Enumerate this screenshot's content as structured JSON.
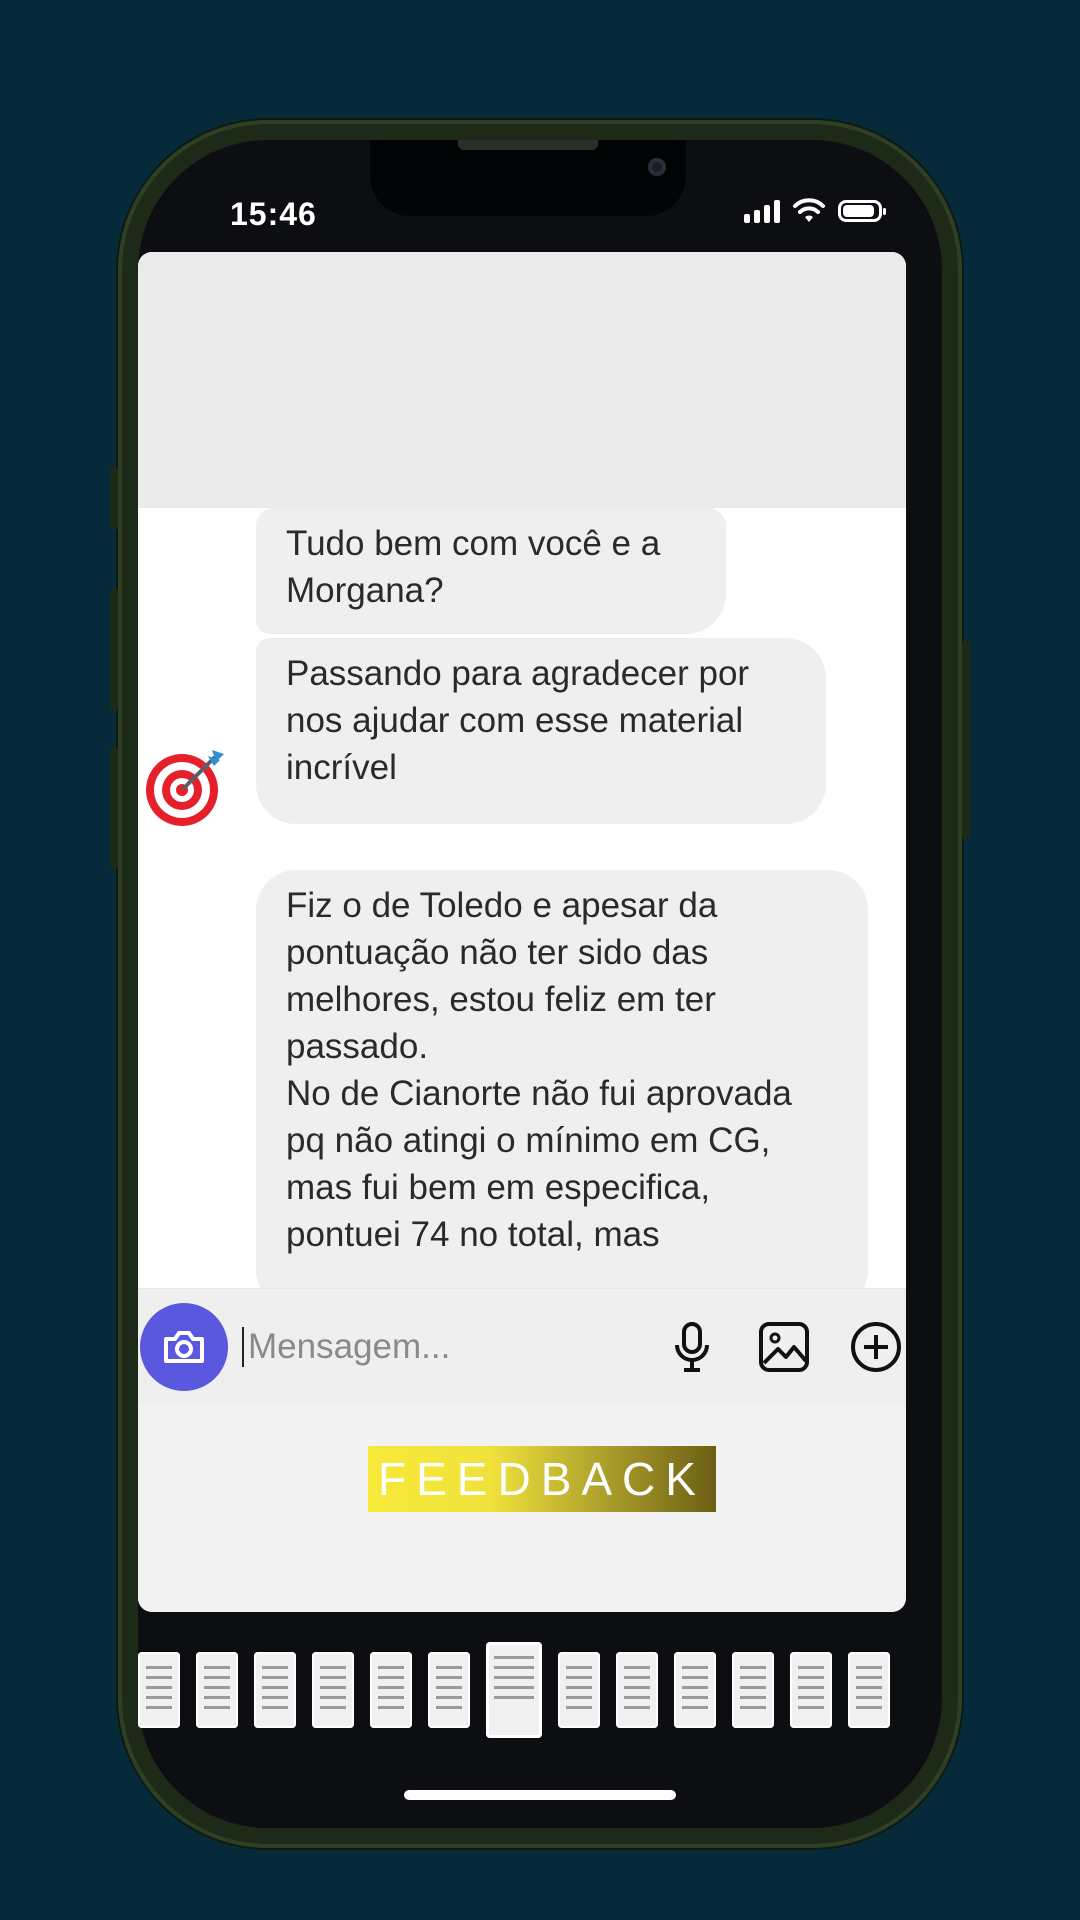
{
  "status_bar": {
    "time": "15:46",
    "signal_bars": 4,
    "battery_level": 0.9
  },
  "chat": {
    "messages": [
      {
        "text": "Tudo bem com você e a\nMorgana?"
      },
      {
        "text": "Passando para agradecer por\nnos ajudar com esse material\nincrível"
      },
      {
        "text": "Fiz o de Toledo e apesar da\npontuação não ter sido das\nmelhores, estou feliz em ter\npassado.\nNo de Cianorte não fui aprovada\npq não atingi o mínimo em CG,\nmas fui bem em especifica,\npontuei 74 no total, mas"
      }
    ],
    "avatar_icon": "target-dart-icon"
  },
  "composer": {
    "placeholder": "Mensagem...",
    "icons": [
      "camera-icon",
      "microphone-icon",
      "gallery-icon",
      "add-icon"
    ],
    "camera_color": "#5a58de"
  },
  "banner": {
    "text": "FEEDBACK",
    "gradient": [
      "#f7ea3a",
      "#6b5f14"
    ]
  },
  "thumbnails": {
    "count": 13,
    "active_index": 6
  },
  "colors": {
    "background": "#062a3a",
    "phone_frame": "#1d2a18",
    "bubble": "#efefef"
  }
}
